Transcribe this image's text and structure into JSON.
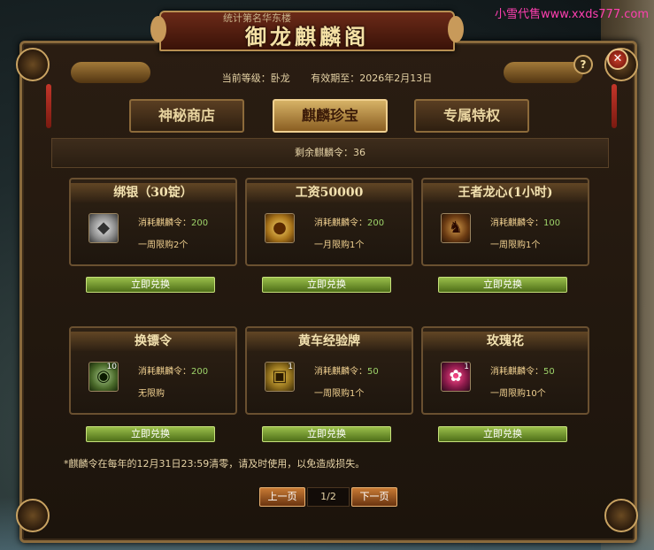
{
  "watermark": "小雪代售www.xxds777.com",
  "banner": {
    "subtitle": "统计第名华东楼",
    "title": "御龙麒麟阁"
  },
  "header": {
    "level_label": "当前等级：卧龙",
    "expiry_label": "有效期至：2026年2月13日",
    "help": "?",
    "close": "✕"
  },
  "tabs": [
    {
      "label": "神秘商店",
      "active": false
    },
    {
      "label": "麒麟珍宝",
      "active": true
    },
    {
      "label": "专属特权",
      "active": false
    }
  ],
  "remaining": "剩余麒麟令：36",
  "items": [
    {
      "name": "绑银（30锭）",
      "cost_label": "消耗麒麟令：",
      "cost": "200",
      "limit": "一周限购2个",
      "count": "",
      "icon": "silver-ingot-icon",
      "button": "立即兑换"
    },
    {
      "name": "工资50000",
      "cost_label": "消耗麒麟令：",
      "cost": "200",
      "limit": "一月限购1个",
      "count": "",
      "icon": "gold-coin-icon",
      "button": "立即兑换"
    },
    {
      "name": "王者龙心(1小时)",
      "cost_label": "消耗麒麟令：",
      "cost": "100",
      "limit": "一周限购1个",
      "count": "",
      "icon": "dragon-heart-icon",
      "button": "立即兑换"
    },
    {
      "name": "换镖令",
      "cost_label": "消耗麒麟令：",
      "cost": "200",
      "limit": "无限购",
      "count": "10",
      "icon": "escort-token-icon",
      "button": "立即兑换"
    },
    {
      "name": "黄车经验牌",
      "cost_label": "消耗麒麟令：",
      "cost": "50",
      "limit": "一周限购1个",
      "count": "1",
      "icon": "cart-exp-plate-icon",
      "button": "立即兑换"
    },
    {
      "name": "玫瑰花",
      "cost_label": "消耗麒麟令：",
      "cost": "50",
      "limit": "一周限购10个",
      "count": "1",
      "icon": "rose-icon",
      "button": "立即兑换"
    }
  ],
  "footnote": "*麒麟令在每年的12月31日23:59清零，请及时使用，以免造成损失。",
  "pager": {
    "prev": "上一页",
    "page": "1/2",
    "next": "下一页"
  }
}
